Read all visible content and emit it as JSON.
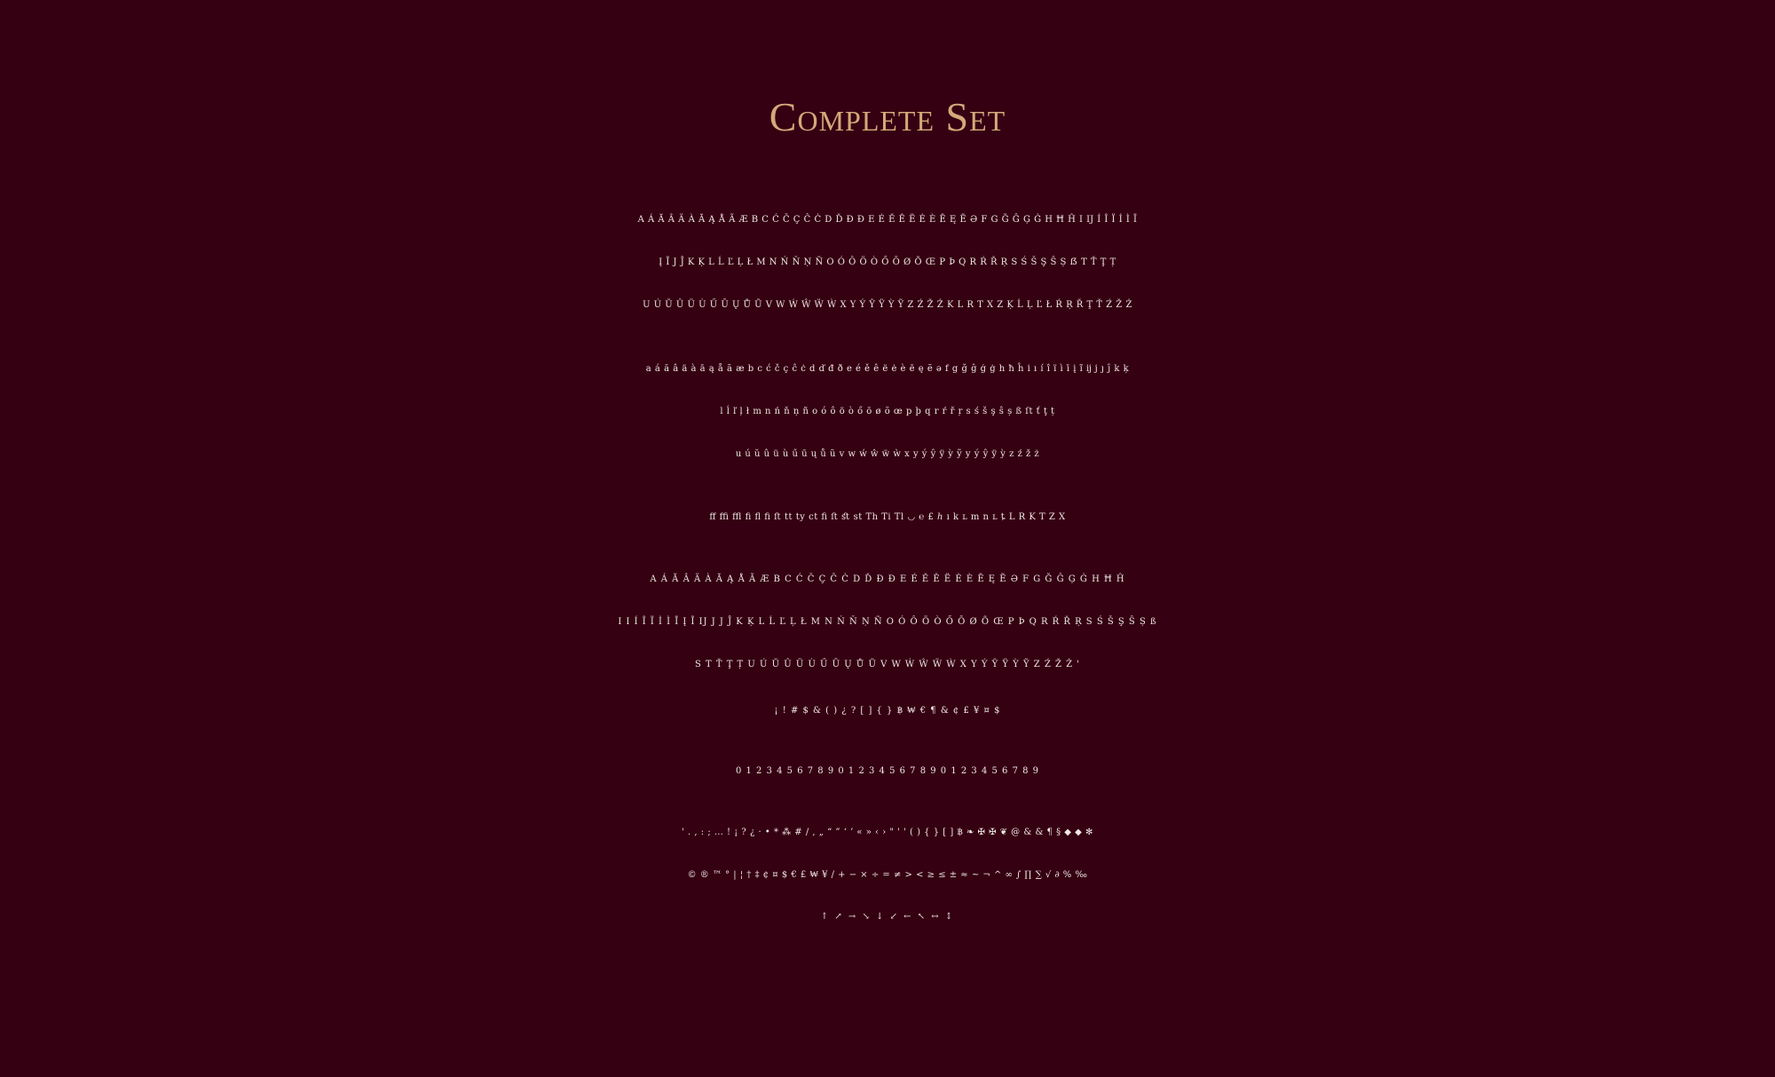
{
  "title": "Complete Set",
  "uppercase": [
    "A Á Ă Â Ä À Ā Ą Å Ã Æ B C Ć Č Ç Ĉ Ċ D Ď Đ Ð E É Ě Ê Ë Ė È Ē Ę Ẽ Ə F G Ğ Ĝ Ģ Ġ H Ħ Ĥ I Ĳ Í Î Ï İ Ì Ī",
    "Į Ĩ J Ĵ K Ķ L Ĺ Ľ Ļ Ł M N Ń Ň Ņ Ñ O Ó Ô Ö Ò Ő Ō Ø Õ Œ P Þ Q R Ŕ Ř Ŗ S Ś Š Ş Ŝ Ș ẞ T Ť Ţ Ț",
    "U Ú Ŭ Û Ü Ù Ű Ū Ų Ů Ũ V W Ẃ Ŵ Ẅ Ẁ X Y Ý Ŷ Ÿ Ỳ Ỹ Z Ź Ž Ż K L R T X Z Ķ Ĺ Ļ Ľ Ł Ŕ Ŗ Ř Ţ Ť Ź Ž Ż"
  ],
  "lowercase": [
    "a á ă â ä à ā ą å ã æ b c ć č ç ĉ ċ d ď đ ð e é ě ê ë ė è ē ę ẽ ə f g ğ ĝ ģ ġ h ħ ĥ i ı í î ï ì ī į ĩ ĳ j ȷ ĵ k ķ",
    "l ĺ ľ ļ ł m n ń ň ņ ñ o ó ô ö ò ő ō ø õ œ p þ q r ŕ ř ŗ s ś š ş ŝ ș ß ſt ť ţ ț",
    "u ú ŭ û ü ù ű ū ų ů ũ v w ẃ ŵ ẅ ẁ x y ý ŷ ÿ ỳ ỹ y ý ŷ ÿ ỳ z ź ž ż"
  ],
  "ligatures": "ﬀ ﬃ ﬄ ﬁ ﬂ ﬁ ﬅ tt ty ct ﬁ ﬅ ﬆ st Th Ti Tl ◡ ℮ £ ℎ ı k ʟ m n ʟ ȶ L R K T Z X",
  "small_caps": [
    "A Á Ă Â Ä À Ā Ą Å Ã Æ B C Ć Č Ç Ĉ Ċ D Ď Đ Ð E É Ě Ê Ë Ė È Ē Ę Ẽ Ə F G Ğ Ĝ Ģ Ġ H Ħ Ĥ",
    "I I Í Î Ï İ Ì Ī Į Ĩ IJ J J Ĵ K Ķ L Ĺ Ľ Ļ Ł M N Ń Ň Ņ Ñ O Ó Ô Ö Ò Ő Ō Ø Õ Œ P Þ Q R Ŕ Ř Ŗ S Ś Š Ş Ŝ Ș ß",
    "S T Ť Ţ Ț U Ú Ŭ Û Ü Ù Ű Ū Ų Ů Ũ V W Ẃ Ŵ Ẅ Ẁ X Y Ý Ŷ Ÿ Ỳ Ỹ Z Ź Ž Ż '"
  ],
  "small_symbols": "¡ ! # $ & ( ) ¿ ? [ ] { } ฿ ₩ € ¶ & ¢ £ ¥ ¤ $",
  "numerals": "0 1 2 3 4 5 6 7 8 9   0 1 2 3 4 5 6 7 8 9   0 1 2 3 4 5 6 7 8 9",
  "punctuation": [
    "' . , : ; … ! ¡ ? ¿ · • * ⁂ # / , „ “ ” ‘ ’ « » ‹ › \" ' ' ( ) { } [ ] ฿ ❧ ✠ ✠ ❦ @ & & ¶ § ◆ ◆ ✻",
    "© ® ™ ° | ¦ † ‡ ¢ ¤ $ € £ ₩ ¥ / + − × ÷ = ≠ > < ≥ ≤ ± ≈ ~ ¬ ^ ∞ ∫ ∏ ∑ √ ∂ % ‰",
    "↑ ↗ → ↘ ↓ ↙ ← ↖ ↔ ↕"
  ]
}
